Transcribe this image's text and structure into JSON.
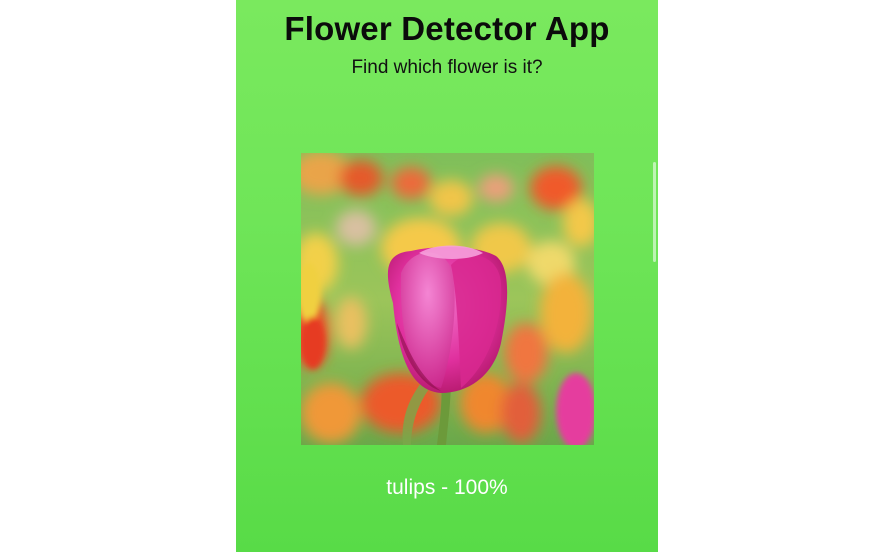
{
  "app": {
    "title": "Flower Detector App",
    "subtitle": "Find which flower is it?"
  },
  "image": {
    "subject": "tulip-photo"
  },
  "prediction": {
    "text": "tulips - 100%"
  },
  "colors": {
    "background_top": "#7ae95e",
    "background_bottom": "#58db47",
    "title_text": "#0b0b0b",
    "result_text": "#ffffff"
  }
}
